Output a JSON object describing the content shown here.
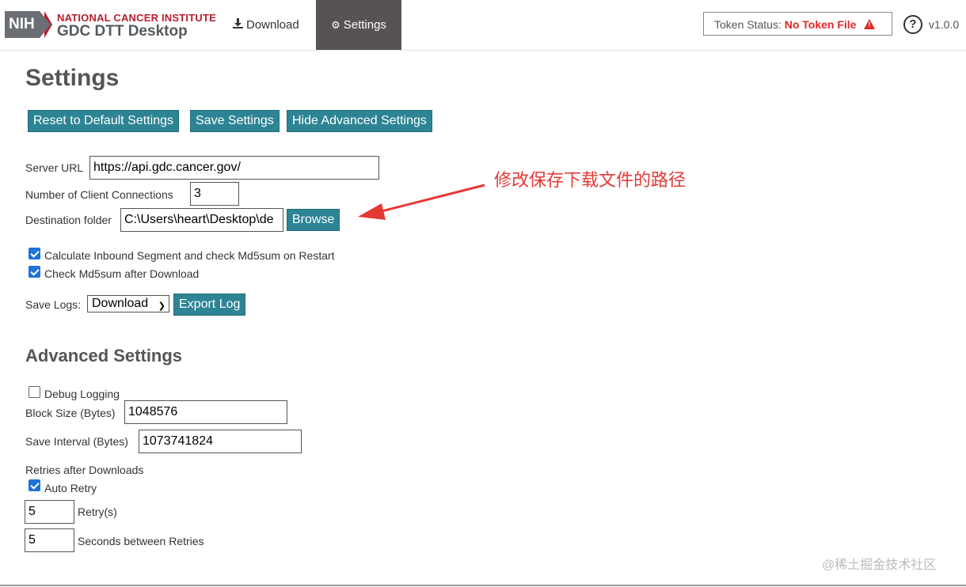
{
  "header": {
    "logo_badge": "NIH",
    "brand_line1": "NATIONAL CANCER INSTITUTE",
    "brand_line2": "GDC DTT Desktop",
    "nav": [
      {
        "label": "Download",
        "icon": "download-icon"
      },
      {
        "label": "Settings",
        "icon": "gear-icon",
        "active": true
      }
    ],
    "token_label": "Token Status:",
    "token_status": "No Token File",
    "help_glyph": "?",
    "version": "v1.0.0"
  },
  "page": {
    "title": "Settings",
    "buttons": {
      "reset": "Reset to Default Settings",
      "save": "Save Settings",
      "hide_advanced": "Hide Advanced Settings"
    },
    "server_url": {
      "label": "Server URL",
      "value": "https://api.gdc.cancer.gov/"
    },
    "client_connections": {
      "label": "Number of Client Connections",
      "value": "3"
    },
    "destination": {
      "label": "Destination folder",
      "value": "C:\\Users\\heart\\Desktop\\de",
      "browse": "Browse"
    },
    "checks": [
      {
        "label": "Calculate Inbound Segment and check Md5sum on Restart",
        "checked": true
      },
      {
        "label": "Check Md5sum after Download",
        "checked": true
      }
    ],
    "save_logs": {
      "label": "Save Logs:",
      "selected": "Download",
      "export": "Export Log"
    }
  },
  "advanced": {
    "title": "Advanced Settings",
    "debug_logging": {
      "label": "Debug Logging",
      "checked": false
    },
    "block_size": {
      "label": "Block Size (Bytes)",
      "value": "1048576"
    },
    "save_interval": {
      "label": "Save Interval (Bytes)",
      "value": "1073741824"
    },
    "retries_heading": "Retries after Downloads",
    "auto_retry": {
      "label": "Auto Retry",
      "checked": true
    },
    "retry_count": {
      "value": "5",
      "label": "Retry(s)"
    },
    "retry_seconds": {
      "value": "5",
      "label": "Seconds between Retries"
    }
  },
  "annotation": {
    "text": "修改保存下载文件的路径",
    "color": "#e53935"
  },
  "watermark": "@稀土掘金技术社区",
  "colors": {
    "button": "#2d8494",
    "active_tab": "#575352",
    "token_error": "#e02828",
    "brand_red": "#b6202e"
  }
}
